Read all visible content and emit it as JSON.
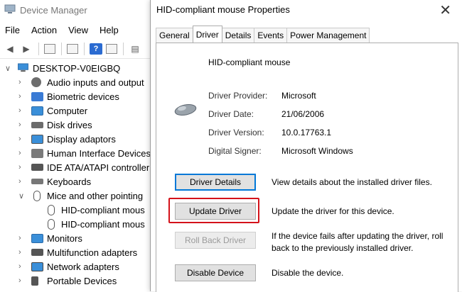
{
  "device_manager": {
    "title": "Device Manager",
    "menu": [
      "File",
      "Action",
      "View",
      "Help"
    ],
    "tree": {
      "root": "DESKTOP-V0EIGBQ",
      "items": [
        {
          "label": "Audio inputs and output",
          "icon": "speaker-icon",
          "color": "#6d6d6d"
        },
        {
          "label": "Biometric devices",
          "icon": "biometric-icon",
          "color": "#3a7bd5"
        },
        {
          "label": "Computer",
          "icon": "computer-icon",
          "color": "#3a8fd9"
        },
        {
          "label": "Disk drives",
          "icon": "disk-drive-icon",
          "color": "#6b6b6b"
        },
        {
          "label": "Display adaptors",
          "icon": "display-icon",
          "color": "#3a8fd9"
        },
        {
          "label": "Human Interface Devices",
          "icon": "hid-icon",
          "color": "#7a7a7a"
        },
        {
          "label": "IDE ATA/ATAPI controller",
          "icon": "ide-controller-icon",
          "color": "#555555"
        },
        {
          "label": "Keyboards",
          "icon": "keyboard-icon",
          "color": "#777777"
        },
        {
          "label": "Mice and other pointing",
          "icon": "mouse-icon",
          "color": "#555555",
          "expanded": true,
          "children": [
            "HID-compliant mous",
            "HID-compliant mous"
          ]
        },
        {
          "label": "Monitors",
          "icon": "monitor-icon",
          "color": "#3a8fd9"
        },
        {
          "label": "Multifunction adapters",
          "icon": "multifunction-icon",
          "color": "#555555"
        },
        {
          "label": "Network adapters",
          "icon": "network-icon",
          "color": "#3a8fd9"
        },
        {
          "label": "Portable Devices",
          "icon": "portable-device-icon",
          "color": "#555555"
        }
      ]
    }
  },
  "dialog": {
    "title": "HID-compliant mouse Properties",
    "close_glyph": "✕",
    "tabs": [
      "General",
      "Driver",
      "Details",
      "Events",
      "Power Management"
    ],
    "active_tab": "Driver",
    "device_name": "HID-compliant mouse",
    "properties": [
      {
        "label": "Driver Provider:",
        "value": "Microsoft"
      },
      {
        "label": "Driver Date:",
        "value": "21/06/2006"
      },
      {
        "label": "Driver Version:",
        "value": "10.0.17763.1"
      },
      {
        "label": "Digital Signer:",
        "value": "Microsoft Windows"
      }
    ],
    "buttons": [
      {
        "label": "Driver Details",
        "desc": "View details about the installed driver files.",
        "state": "focused"
      },
      {
        "label": "Update Driver",
        "desc": "Update the driver for this device.",
        "state": "highlighted"
      },
      {
        "label": "Roll Back Driver",
        "desc": "If the device fails after updating the driver, roll back to the previously installed driver.",
        "state": "disabled"
      },
      {
        "label": "Disable Device",
        "desc": "Disable the device.",
        "state": "normal"
      }
    ],
    "highlight_color": "#d4121a"
  }
}
